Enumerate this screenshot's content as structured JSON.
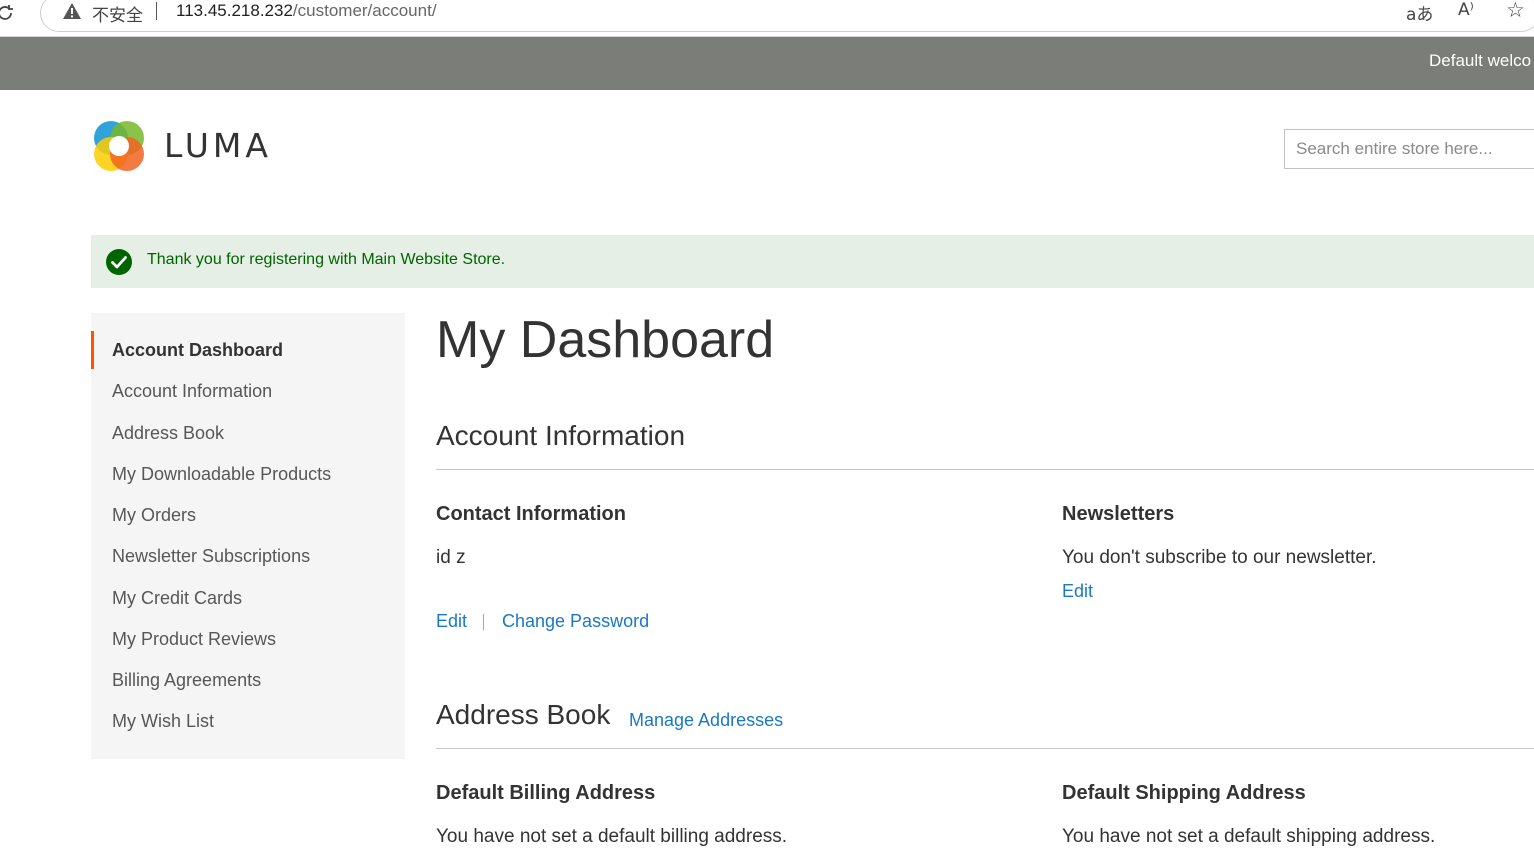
{
  "browser": {
    "insecure_label": "不安全",
    "url_host": "113.45.218.232",
    "url_path": "/customer/account/",
    "translate_icon": "aあ",
    "read_aloud_icon": "A⁾",
    "favorite_icon": "☆"
  },
  "panel": {
    "welcome": "Default welco"
  },
  "header": {
    "logo_text": "LUMA",
    "search_placeholder": "Search entire store here..."
  },
  "message": {
    "text": "Thank you for registering with Main Website Store.",
    "color": "#006400",
    "background": "#e5efe5"
  },
  "sidebar": {
    "items": [
      {
        "label": "Account Dashboard",
        "current": true
      },
      {
        "label": "Account Information"
      },
      {
        "label": "Address Book"
      },
      {
        "label": "My Downloadable Products"
      },
      {
        "label": "My Orders"
      },
      {
        "label": "Newsletter Subscriptions"
      },
      {
        "label": "My Credit Cards"
      },
      {
        "label": "My Product Reviews"
      },
      {
        "label": "Billing Agreements"
      },
      {
        "label": "My Wish List"
      }
    ]
  },
  "main": {
    "page_title": "My Dashboard",
    "account_info": {
      "title": "Account Information",
      "contact": {
        "title": "Contact Information",
        "name": "id z",
        "edit_label": "Edit",
        "change_password_label": "Change Password"
      },
      "newsletters": {
        "title": "Newsletters",
        "text": "You don't subscribe to our newsletter.",
        "edit_label": "Edit"
      }
    },
    "address_book": {
      "title": "Address Book",
      "manage_label": "Manage Addresses",
      "billing": {
        "title": "Default Billing Address",
        "text": "You have not set a default billing address."
      },
      "shipping": {
        "title": "Default Shipping Address",
        "text": "You have not set a default shipping address."
      }
    }
  },
  "colors": {
    "accent": "#ff5501",
    "link": "#1979c3",
    "panel": "#7b7d78"
  }
}
